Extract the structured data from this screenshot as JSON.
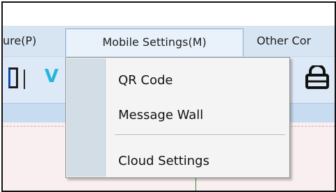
{
  "menubar": {
    "partial_left_label": "ure(P)",
    "mobile_settings_label": "Mobile Settings(M)",
    "partial_right_label": "Other Cor"
  },
  "toolbar": {
    "partial_letter": "V"
  },
  "dropdown": {
    "items": [
      {
        "label": "QR Code"
      },
      {
        "label": "Message Wall"
      },
      {
        "label": "Cloud Settings"
      }
    ]
  },
  "colors": {
    "menubar_bg": "#d7e4f2",
    "dropdown_bg": "#f4f4f4",
    "dropdown_icon_column": "#d3dde6",
    "canvas_bg": "#f9eef0",
    "accent_cyan": "#23b7db"
  },
  "icons": [
    "lock-icon"
  ]
}
